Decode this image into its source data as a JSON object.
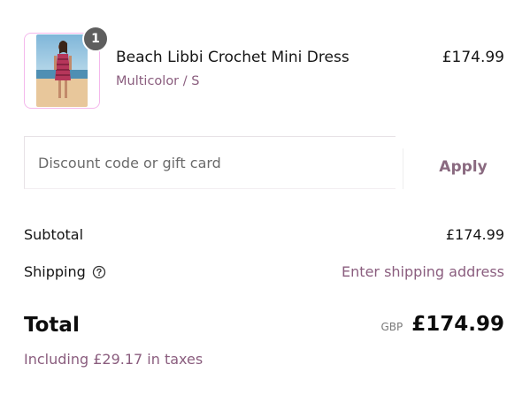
{
  "product": {
    "quantity": "1",
    "title": "Beach Libbi Crochet Mini Dress",
    "variant": "Multicolor / S",
    "price": "£174.99"
  },
  "discount": {
    "placeholder": "Discount code or gift card",
    "apply_label": "Apply"
  },
  "totals": {
    "subtotal_label": "Subtotal",
    "subtotal_value": "£174.99",
    "shipping_label": "Shipping",
    "shipping_value": "Enter shipping address",
    "total_label": "Total",
    "currency": "GBP",
    "total_value": "£174.99",
    "tax_note": "Including £29.17 in taxes"
  },
  "colors": {
    "accent": "#8a5d7e",
    "thumb_border": "#f4b8ec",
    "badge": "#5e5e5e"
  },
  "icons": {
    "shipping_help": "question-circle-icon"
  }
}
